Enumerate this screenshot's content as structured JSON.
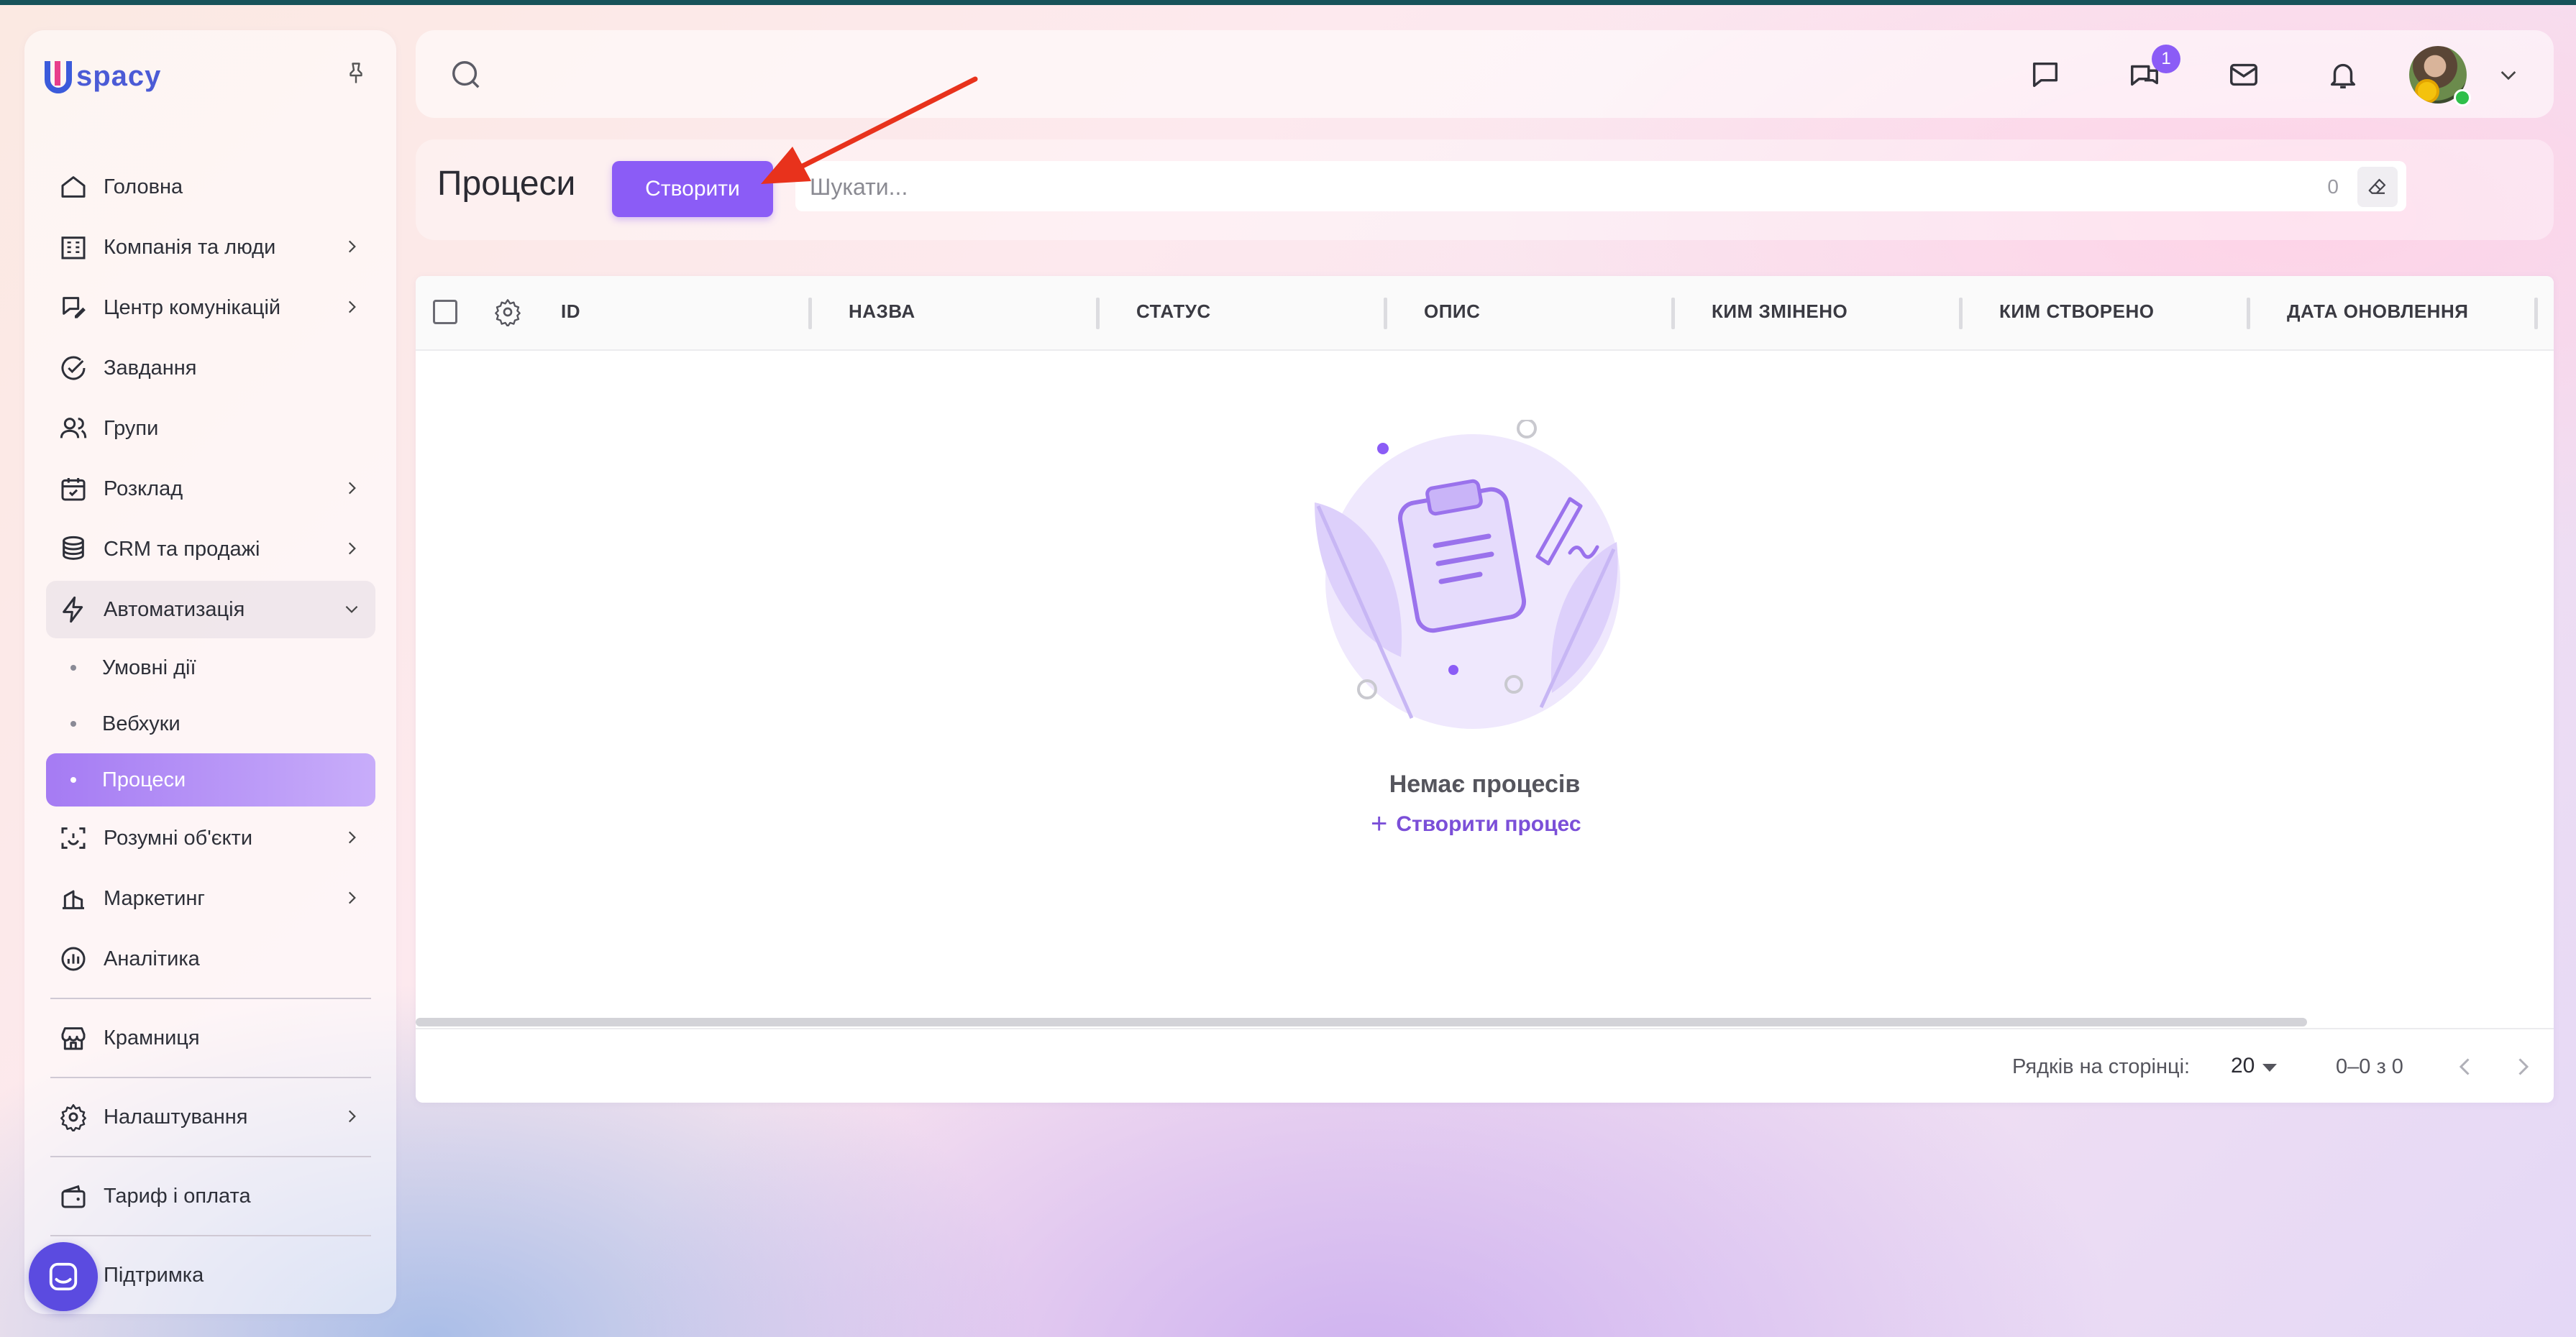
{
  "brand": {
    "logo_text": "spacy",
    "logo_letter": "U"
  },
  "sidebar": {
    "items": [
      {
        "label": "Головна",
        "icon": "home-icon"
      },
      {
        "label": "Компанія та люди",
        "icon": "company-icon"
      },
      {
        "label": "Центр комунікацій",
        "icon": "communications-icon"
      },
      {
        "label": "Завдання",
        "icon": "tasks-icon"
      },
      {
        "label": "Групи",
        "icon": "groups-icon"
      },
      {
        "label": "Розклад",
        "icon": "calendar-icon"
      },
      {
        "label": "CRM та продажі",
        "icon": "crm-icon"
      },
      {
        "label": "Автоматизація",
        "icon": "automation-icon",
        "expanded": true
      },
      {
        "label": "Розумні об'єкти",
        "icon": "smart-objects-icon"
      },
      {
        "label": "Маркетинг",
        "icon": "marketing-icon"
      },
      {
        "label": "Аналітика",
        "icon": "analytics-icon"
      },
      {
        "label": "Крамниця",
        "icon": "store-icon"
      },
      {
        "label": "Налаштування",
        "icon": "settings-icon"
      },
      {
        "label": "Тариф і оплата",
        "icon": "wallet-icon"
      },
      {
        "label": "Підтримка",
        "icon": "support-icon"
      }
    ],
    "subitems": [
      {
        "label": "Умовні дії"
      },
      {
        "label": "Вебхуки"
      },
      {
        "label": "Процеси",
        "active": true
      }
    ]
  },
  "header": {
    "chat_badge": "1",
    "icons": [
      "chat-icon",
      "messenger-icon",
      "mail-icon",
      "bell-icon"
    ]
  },
  "toolbar": {
    "title": "Процеси",
    "create_label": "Створити",
    "search_placeholder": "Шукати...",
    "search_count": "0"
  },
  "table": {
    "columns": [
      "ID",
      "НАЗВА",
      "СТАТУС",
      "ОПИС",
      "КИМ ЗМІНЕНО",
      "КИМ СТВОРЕНО",
      "ДАТА ОНОВЛЕННЯ"
    ],
    "empty_text": "Немає процесів",
    "empty_action": "Створити процес",
    "rows_per_page_label": "Рядків на сторінці:",
    "rows_per_page": "20",
    "range": "0–0 з 0"
  },
  "colors": {
    "accent": "#8b5cf6",
    "active_gradient_start": "#a57bf3",
    "annotation_arrow": "#e8321c"
  }
}
